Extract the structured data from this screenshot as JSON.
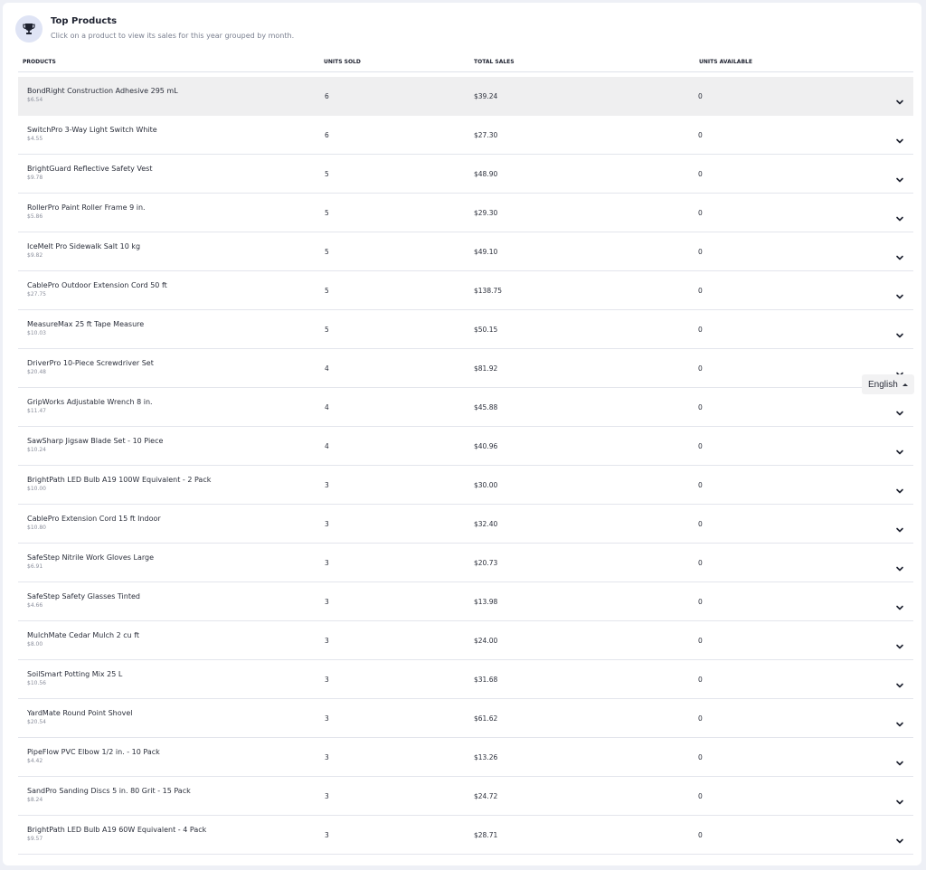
{
  "header": {
    "title": "Top Products",
    "subtitle": "Click on a product to view its sales for this year grouped by month."
  },
  "columns": {
    "products": "PRODUCTS",
    "units_sold": "UNITS SOLD",
    "total_sales": "TOTAL SALES",
    "units_available": "UNITS AVAILABLE"
  },
  "rows": [
    {
      "name": "BondRight Construction Adhesive 295 mL",
      "price": "$6.54",
      "units_sold": "6",
      "total_sales": "$39.24",
      "units_available": "0",
      "selected": true
    },
    {
      "name": "SwitchPro 3-Way Light Switch White",
      "price": "$4.55",
      "units_sold": "6",
      "total_sales": "$27.30",
      "units_available": "0"
    },
    {
      "name": "BrightGuard Reflective Safety Vest",
      "price": "$9.78",
      "units_sold": "5",
      "total_sales": "$48.90",
      "units_available": "0"
    },
    {
      "name": "RollerPro Paint Roller Frame 9 in.",
      "price": "$5.86",
      "units_sold": "5",
      "total_sales": "$29.30",
      "units_available": "0"
    },
    {
      "name": "IceMelt Pro Sidewalk Salt 10 kg",
      "price": "$9.82",
      "units_sold": "5",
      "total_sales": "$49.10",
      "units_available": "0"
    },
    {
      "name": "CablePro Outdoor Extension Cord 50 ft",
      "price": "$27.75",
      "units_sold": "5",
      "total_sales": "$138.75",
      "units_available": "0"
    },
    {
      "name": "MeasureMax 25 ft Tape Measure",
      "price": "$10.03",
      "units_sold": "5",
      "total_sales": "$50.15",
      "units_available": "0"
    },
    {
      "name": "DriverPro 10-Piece Screwdriver Set",
      "price": "$20.48",
      "units_sold": "4",
      "total_sales": "$81.92",
      "units_available": "0"
    },
    {
      "name": "GripWorks Adjustable Wrench 8 in.",
      "price": "$11.47",
      "units_sold": "4",
      "total_sales": "$45.88",
      "units_available": "0"
    },
    {
      "name": "SawSharp Jigsaw Blade Set - 10 Piece",
      "price": "$10.24",
      "units_sold": "4",
      "total_sales": "$40.96",
      "units_available": "0"
    },
    {
      "name": "BrightPath LED Bulb A19 100W Equivalent - 2 Pack",
      "price": "$10.00",
      "units_sold": "3",
      "total_sales": "$30.00",
      "units_available": "0"
    },
    {
      "name": "CablePro Extension Cord 15 ft Indoor",
      "price": "$10.80",
      "units_sold": "3",
      "total_sales": "$32.40",
      "units_available": "0"
    },
    {
      "name": "SafeStep Nitrile Work Gloves Large",
      "price": "$6.91",
      "units_sold": "3",
      "total_sales": "$20.73",
      "units_available": "0"
    },
    {
      "name": "SafeStep Safety Glasses Tinted",
      "price": "$4.66",
      "units_sold": "3",
      "total_sales": "$13.98",
      "units_available": "0"
    },
    {
      "name": "MulchMate Cedar Mulch 2 cu ft",
      "price": "$8.00",
      "units_sold": "3",
      "total_sales": "$24.00",
      "units_available": "0"
    },
    {
      "name": "SoilSmart Potting Mix 25 L",
      "price": "$10.56",
      "units_sold": "3",
      "total_sales": "$31.68",
      "units_available": "0"
    },
    {
      "name": "YardMate Round Point Shovel",
      "price": "$20.54",
      "units_sold": "3",
      "total_sales": "$61.62",
      "units_available": "0"
    },
    {
      "name": "PipeFlow PVC Elbow 1/2 in. - 10 Pack",
      "price": "$4.42",
      "units_sold": "3",
      "total_sales": "$13.26",
      "units_available": "0"
    },
    {
      "name": "SandPro Sanding Discs 5 in. 80 Grit - 15 Pack",
      "price": "$8.24",
      "units_sold": "3",
      "total_sales": "$24.72",
      "units_available": "0"
    },
    {
      "name": "BrightPath LED Bulb A19 60W Equivalent - 4 Pack",
      "price": "$9.57",
      "units_sold": "3",
      "total_sales": "$28.71",
      "units_available": "0"
    }
  ],
  "language": {
    "label": "English"
  },
  "icons": {
    "header": "trophy-icon",
    "row_toggle": "chevron-down-icon",
    "language_toggle": "caret-up-icon"
  },
  "colors": {
    "icon_badge_bg": "#dfe4f5",
    "selected_row_bg": "#efeff0"
  }
}
